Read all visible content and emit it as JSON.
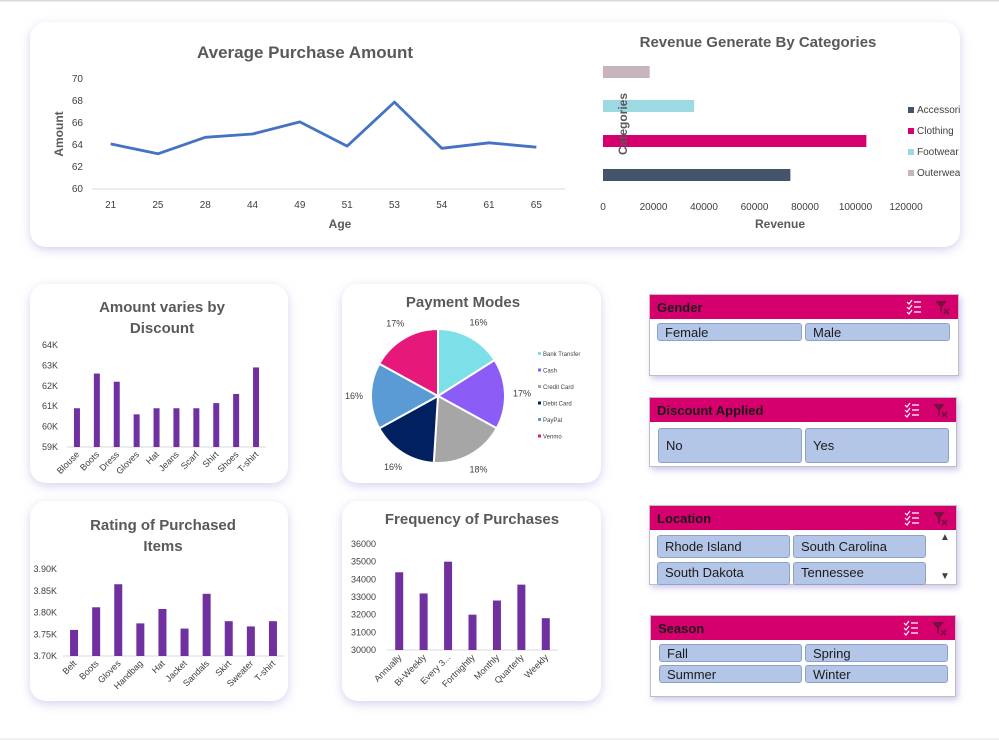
{
  "colors": {
    "line": "#4472c4",
    "purple": "#7030a0",
    "slicer_head": "#d5006d",
    "slicer_btn": "#b4c6e7",
    "card_shadow": "#8c78d2"
  },
  "chart_data": [
    {
      "id": "avg_purchase",
      "type": "line",
      "title": "Average Purchase Amount",
      "xlabel": "Age",
      "ylabel": "Amount",
      "categories": [
        "21",
        "25",
        "28",
        "44",
        "49",
        "51",
        "53",
        "54",
        "61",
        "65"
      ],
      "values": [
        64.1,
        63.2,
        64.7,
        65.0,
        66.1,
        63.9,
        67.9,
        63.7,
        64.2,
        63.8
      ],
      "ylim": [
        60,
        70
      ],
      "yticks": [
        "60",
        "62",
        "64",
        "66",
        "68",
        "70"
      ],
      "grid": false,
      "legend": "none"
    },
    {
      "id": "revenue_categories",
      "type": "bar",
      "orientation": "horizontal",
      "title": "Revenue Generate By Categories",
      "xlabel": "Revenue",
      "ylabel": "Categories",
      "categories": [
        "Accessories",
        "Clothing",
        "Footwear",
        "Outerwear"
      ],
      "values": [
        74200,
        104300,
        36100,
        18500
      ],
      "colors": [
        "#44546a",
        "#d5006d",
        "#9dd9e3",
        "#c8b4be"
      ],
      "xlim": [
        0,
        120000
      ],
      "xticks": [
        "0",
        "20000",
        "40000",
        "60000",
        "80000",
        "100000",
        "120000"
      ],
      "legend": "right"
    },
    {
      "id": "amount_discount",
      "type": "bar",
      "title": "Amount varies by Discount",
      "title_lines": [
        "Amount varies by",
        "Discount"
      ],
      "categories": [
        "Blouse",
        "Boots",
        "Dress",
        "Gloves",
        "Hat",
        "Jeans",
        "Scarf",
        "Shirt",
        "Shoes",
        "T-shirt"
      ],
      "values": [
        60900,
        62600,
        62200,
        60600,
        60900,
        60900,
        60900,
        61150,
        61600,
        62900
      ],
      "ylim": [
        59000,
        64000
      ],
      "yticks": [
        "59K",
        "60K",
        "61K",
        "62K",
        "63K",
        "64K"
      ],
      "color": "#7030a0"
    },
    {
      "id": "payment_modes",
      "type": "pie",
      "title": "Payment Modes",
      "labels": [
        "Bank Transfer",
        "Cash",
        "Credit Card",
        "Debit Card",
        "PayPal",
        "Venmo"
      ],
      "values": [
        16,
        17,
        18,
        16,
        16,
        17
      ],
      "value_labels": [
        "16%",
        "17%",
        "18%",
        "16%",
        "16%",
        "17%"
      ],
      "colors": [
        "#7ddfe8",
        "#8b5cf6",
        "#a6a6a6",
        "#002060",
        "#5b9bd5",
        "#e6197a"
      ],
      "legend": "right"
    },
    {
      "id": "rating_items",
      "type": "bar",
      "title": "Rating of Purchased Items",
      "title_lines": [
        "Rating of Purchased",
        "Items"
      ],
      "categories": [
        "Belt",
        "Boots",
        "Gloves",
        "Handbag",
        "Hat",
        "Jacket",
        "Sandals",
        "Skirt",
        "Sweater",
        "T-shirt"
      ],
      "values": [
        3760,
        3812,
        3865,
        3775,
        3808,
        3763,
        3843,
        3780,
        3768,
        3780
      ],
      "ylim": [
        3700,
        3900
      ],
      "yticks": [
        "3.70K",
        "3.75K",
        "3.80K",
        "3.85K",
        "3.90K"
      ],
      "color": "#7030a0"
    },
    {
      "id": "purchase_frequency",
      "type": "bar",
      "title": "Frequency of Purchases",
      "categories": [
        "Annually",
        "Bi-Weekly",
        "Every 3...",
        "Fortnightly",
        "Monthly",
        "Quarterly",
        "Weekly"
      ],
      "values": [
        34400,
        33200,
        35000,
        32000,
        32800,
        33700,
        31800
      ],
      "ylim": [
        30000,
        36000
      ],
      "yticks": [
        "30000",
        "31000",
        "32000",
        "33000",
        "34000",
        "35000",
        "36000"
      ],
      "color": "#7030a0"
    }
  ],
  "slicers": {
    "gender": {
      "title": "Gender",
      "items": [
        "Female",
        "Male"
      ]
    },
    "discount": {
      "title": "Discount Applied",
      "items": [
        "No",
        "Yes"
      ]
    },
    "location": {
      "title": "Location",
      "items": [
        "Rhode Island",
        "South Carolina",
        "South Dakota",
        "Tennessee"
      ],
      "scroll_up": "▲",
      "scroll_down": "▼"
    },
    "season": {
      "title": "Season",
      "items": [
        "Fall",
        "Spring",
        "Summer",
        "Winter"
      ]
    }
  },
  "icons": {
    "multiselect": "multi-select-icon",
    "clear_filter": "clear-filter-icon"
  }
}
